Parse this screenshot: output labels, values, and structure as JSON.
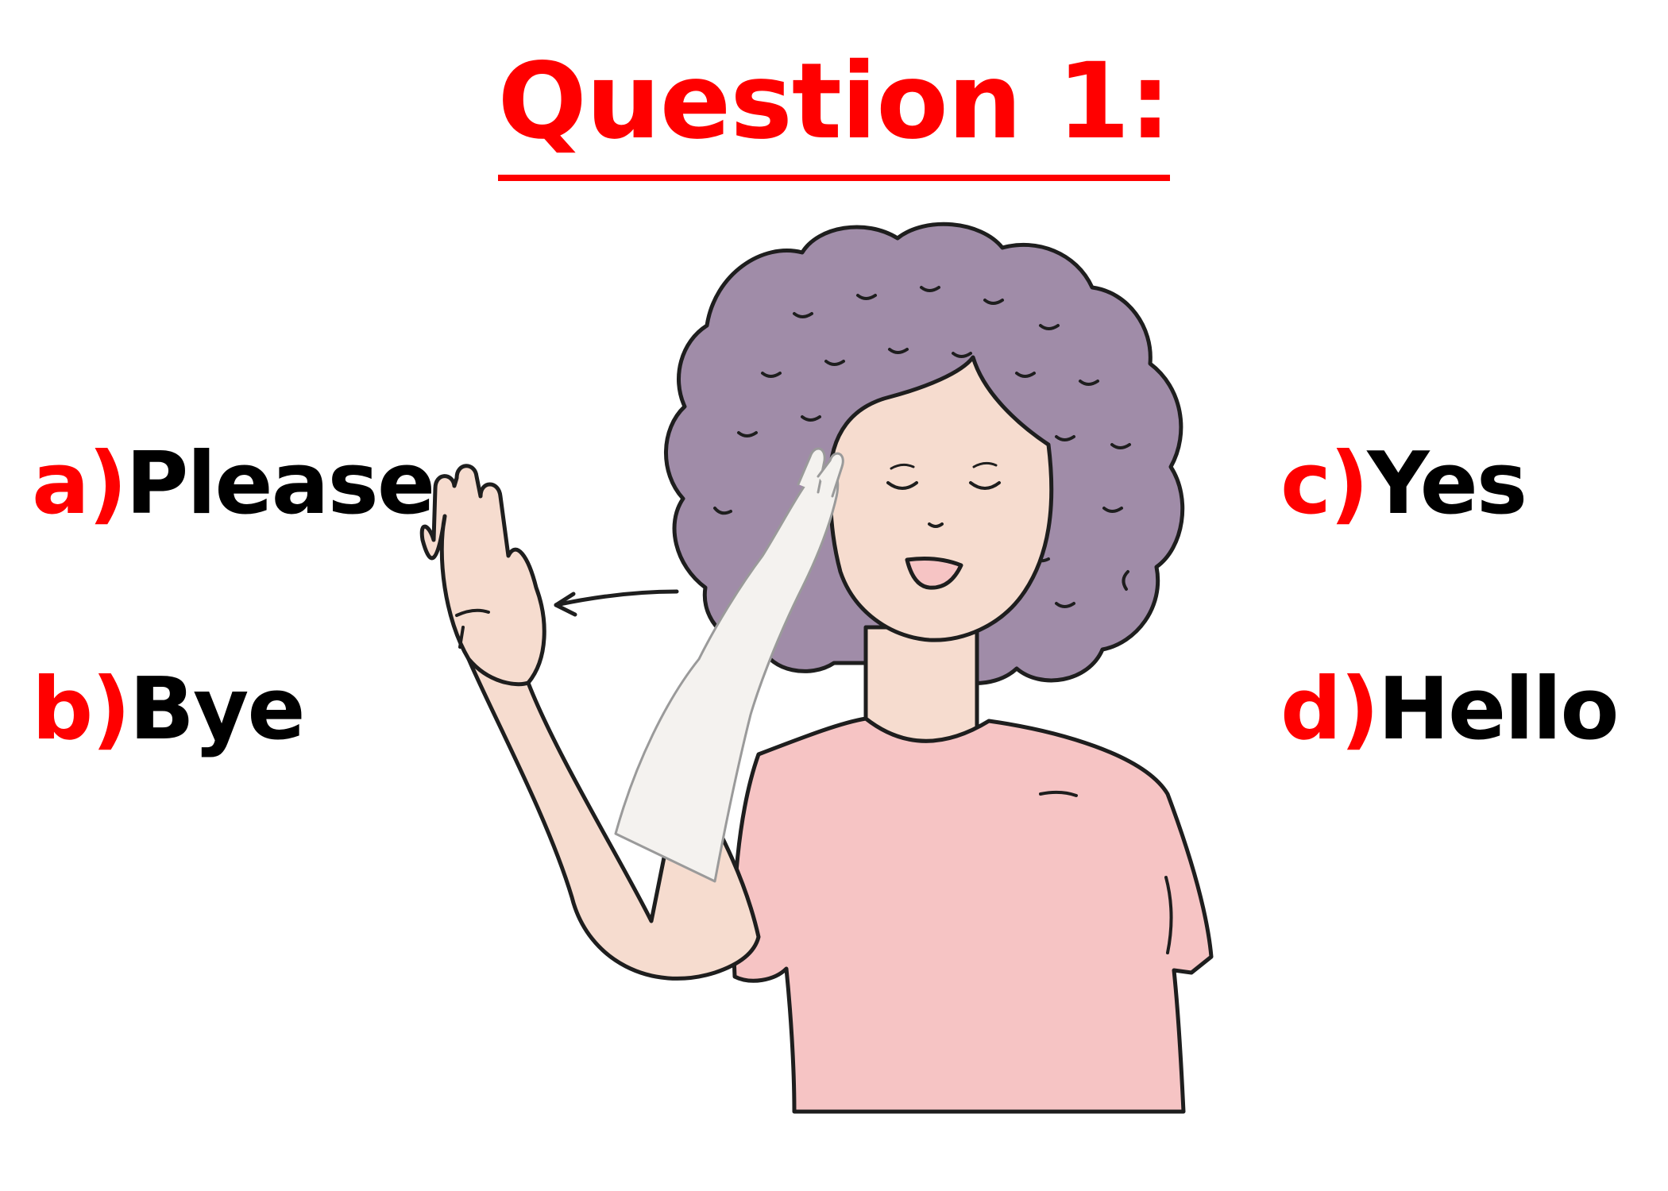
{
  "question": {
    "title": "Question 1:"
  },
  "options": [
    {
      "letter": "a)",
      "text": "Please"
    },
    {
      "letter": "b)",
      "text": "Bye"
    },
    {
      "letter": "c)",
      "text": "Yes"
    },
    {
      "letter": "d)",
      "text": "Hello"
    }
  ],
  "illustration": {
    "subject": "woman-signing-illustration",
    "colors": {
      "hair": "#a08ca8",
      "skin": "#f6dccf",
      "shirt": "#f6c4c4",
      "outline": "#1e1e1e",
      "ghost_arm": "#f4f2ef"
    }
  },
  "colors": {
    "accent": "#ff0000",
    "text": "#000000",
    "background": "#ffffff"
  }
}
